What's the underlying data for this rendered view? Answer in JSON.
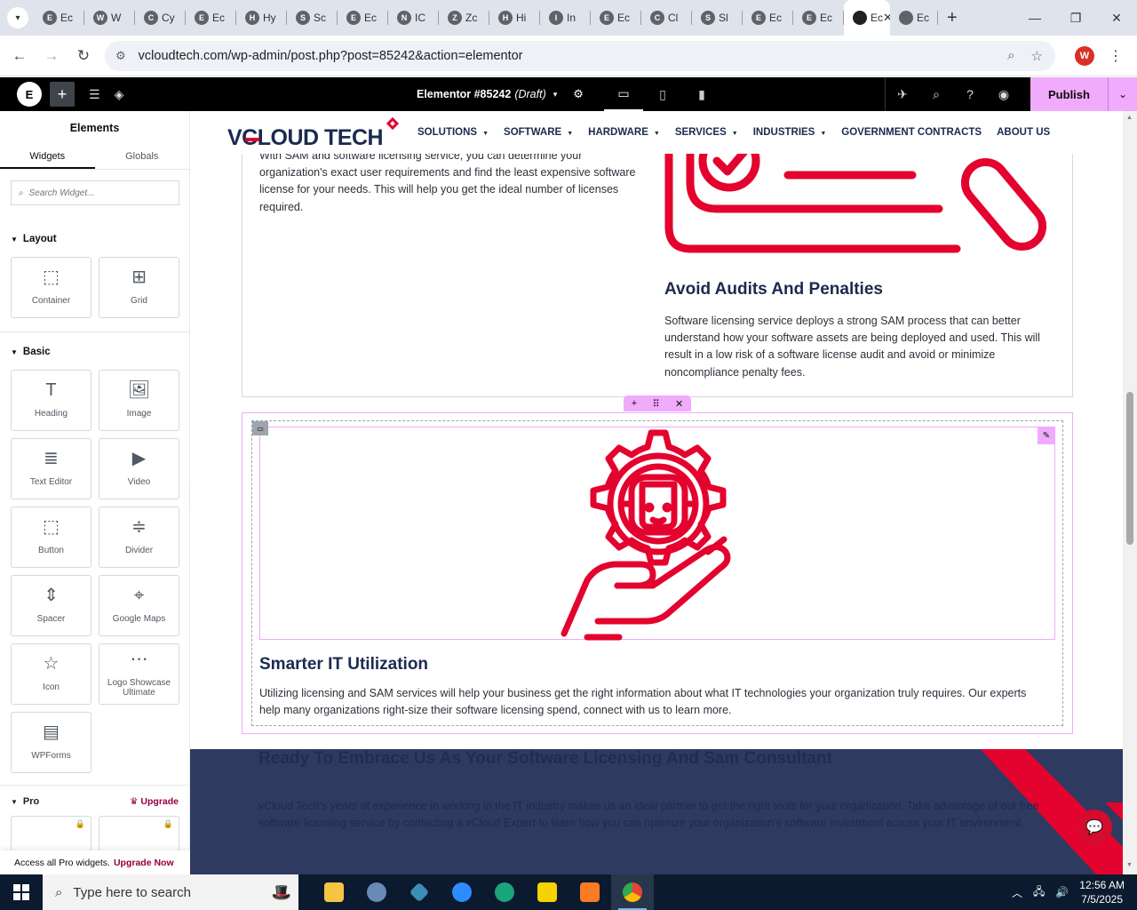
{
  "browser": {
    "tabs": [
      {
        "label": "Ec",
        "icon": "E"
      },
      {
        "label": "W",
        "icon": "W"
      },
      {
        "label": "Cy",
        "icon": "C"
      },
      {
        "label": "Ec",
        "icon": "E"
      },
      {
        "label": "Hy",
        "icon": "H"
      },
      {
        "label": "Sc",
        "icon": "S"
      },
      {
        "label": "Ec",
        "icon": "E"
      },
      {
        "label": "IC",
        "icon": "N"
      },
      {
        "label": "Zc",
        "icon": "Z"
      },
      {
        "label": "Hi",
        "icon": "H"
      },
      {
        "label": "In",
        "icon": "I"
      },
      {
        "label": "Ec",
        "icon": "E"
      },
      {
        "label": "Cl",
        "icon": "C"
      },
      {
        "label": "Sl",
        "icon": "S"
      },
      {
        "label": "Ec",
        "icon": "E"
      },
      {
        "label": "Ec",
        "icon": "E"
      }
    ],
    "active_tab": {
      "label": "Ec",
      "icon": "E"
    },
    "last_tab": {
      "label": "Ec",
      "icon": "E"
    },
    "url": "vcloudtech.com/wp-admin/post.php?post=85242&action=elementor",
    "profile_initial": "W"
  },
  "elementor": {
    "doc_title": "Elementor #85242",
    "doc_status": "(Draft)",
    "publish_label": "Publish"
  },
  "panel": {
    "title": "Elements",
    "tabs": [
      "Widgets",
      "Globals"
    ],
    "search_placeholder": "Search Widget...",
    "layout_title": "Layout",
    "layout_widgets": [
      {
        "label": "Container",
        "icon": "container-icon"
      },
      {
        "label": "Grid",
        "icon": "grid-icon"
      }
    ],
    "basic_title": "Basic",
    "basic_widgets": [
      {
        "label": "Heading",
        "icon": "heading-icon"
      },
      {
        "label": "Image",
        "icon": "image-icon"
      },
      {
        "label": "Text Editor",
        "icon": "text-editor-icon"
      },
      {
        "label": "Video",
        "icon": "video-icon"
      },
      {
        "label": "Button",
        "icon": "button-icon"
      },
      {
        "label": "Divider",
        "icon": "divider-icon"
      },
      {
        "label": "Spacer",
        "icon": "spacer-icon"
      },
      {
        "label": "Google Maps",
        "icon": "google-maps-icon"
      },
      {
        "label": "Icon",
        "icon": "star-icon"
      },
      {
        "label": "Logo Showcase Ultimate",
        "icon": "logo-showcase-icon"
      },
      {
        "label": "WPForms",
        "icon": "wpforms-icon"
      }
    ],
    "pro_title": "Pro",
    "upgrade_label": "Upgrade",
    "pro_note": "Access all Pro widgets.",
    "pro_note_link": "Upgrade Now"
  },
  "site": {
    "logo_text": "VCLOUD TECH",
    "nav": [
      {
        "label": "SOLUTIONS",
        "dropdown": true
      },
      {
        "label": "SOFTWARE",
        "dropdown": true
      },
      {
        "label": "HARDWARE",
        "dropdown": true
      },
      {
        "label": "SERVICES",
        "dropdown": true
      },
      {
        "label": "INDUSTRIES",
        "dropdown": true
      },
      {
        "label": "GOVERNMENT CONTRACTS",
        "dropdown": false
      },
      {
        "label": "ABOUT US",
        "dropdown": false
      }
    ],
    "intro_text": "With SAM and software licensing service, you can determine your organization's exact user requirements and find the least expensive software license for your needs. This will help you get the ideal number of licenses required.",
    "audits_title": "Avoid Audits And Penalties",
    "audits_text": "Software licensing service deploys a strong SAM process that can better understand how your software assets are being deployed and used. This will result in a low risk of a software license audit and avoid or minimize noncompliance penalty fees.",
    "smarter_title": "Smarter IT Utilization",
    "smarter_text": "Utilizing licensing and SAM services will help your business get the right information about what IT technologies your organization truly requires. Our experts help many organizations right-size their software licensing spend, connect with us to learn more.",
    "cta_title": "Ready To Embrace Us As Your Software Licensing And Sam Consultant",
    "cta_text": "vCloud Tech's years of experience in working in the IT industry makes us an ideal partner to get the right tools for your organization. Take advantage of our free software licensing service by contacting a vCloud Expert to learn how you can optimize your organization's software investment across your IT environment.",
    "brand_color": "#e4032e",
    "heading_color": "#1b2a4e"
  },
  "taskbar": {
    "search_placeholder": "Type here to search",
    "time": "12:56 AM",
    "date": "7/5/2025"
  }
}
